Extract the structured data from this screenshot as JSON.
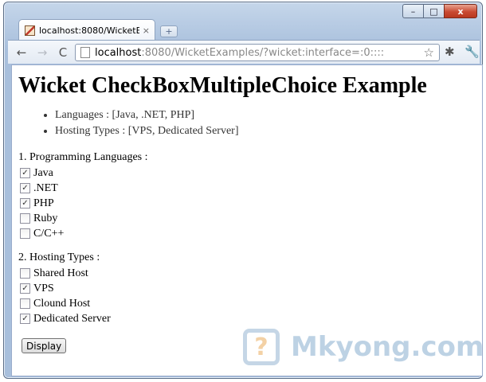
{
  "browser": {
    "tab": {
      "title": "localhost:8080/WicketExa...",
      "close_glyph": "×"
    },
    "new_tab_glyph": "+",
    "window_controls": {
      "minimize": "–",
      "maximize": "□",
      "close": "x"
    },
    "toolbar": {
      "back_glyph": "←",
      "forward_glyph": "→",
      "reload_glyph": "C",
      "url_host": "localhost",
      "url_rest": ":8080/WicketExamples/?wicket:interface=:0::::",
      "star_glyph": "☆",
      "extension_glyph": "✱",
      "wrench_glyph": "🔧"
    }
  },
  "page": {
    "heading": "Wicket CheckBoxMultipleChoice Example",
    "feedback": [
      "Languages : [Java, .NET, PHP]",
      "Hosting Types : [VPS, Dedicated Server]"
    ],
    "languages": {
      "title": "1. Programming Languages :",
      "options": [
        {
          "label": "Java",
          "checked": true,
          "mark": "✓"
        },
        {
          "label": ".NET",
          "checked": true,
          "mark": "✓"
        },
        {
          "label": "PHP",
          "checked": true,
          "mark": "✓"
        },
        {
          "label": "Ruby",
          "checked": false,
          "mark": ""
        },
        {
          "label": "C/C++",
          "checked": false,
          "mark": ""
        }
      ]
    },
    "hosting": {
      "title": "2. Hosting Types :",
      "options": [
        {
          "label": "Shared Host",
          "checked": false,
          "mark": ""
        },
        {
          "label": "VPS",
          "checked": true,
          "mark": "✓"
        },
        {
          "label": "Clound Host",
          "checked": false,
          "mark": ""
        },
        {
          "label": "Dedicated Server",
          "checked": true,
          "mark": "✓"
        }
      ]
    },
    "submit_label": "Display"
  },
  "watermark": {
    "logo_glyph": "?",
    "text": "Mkyong.com"
  },
  "colors": {
    "window_frame": "#a8bfdc",
    "close_button": "#c94a32",
    "watermark": "#6f9cc4"
  }
}
